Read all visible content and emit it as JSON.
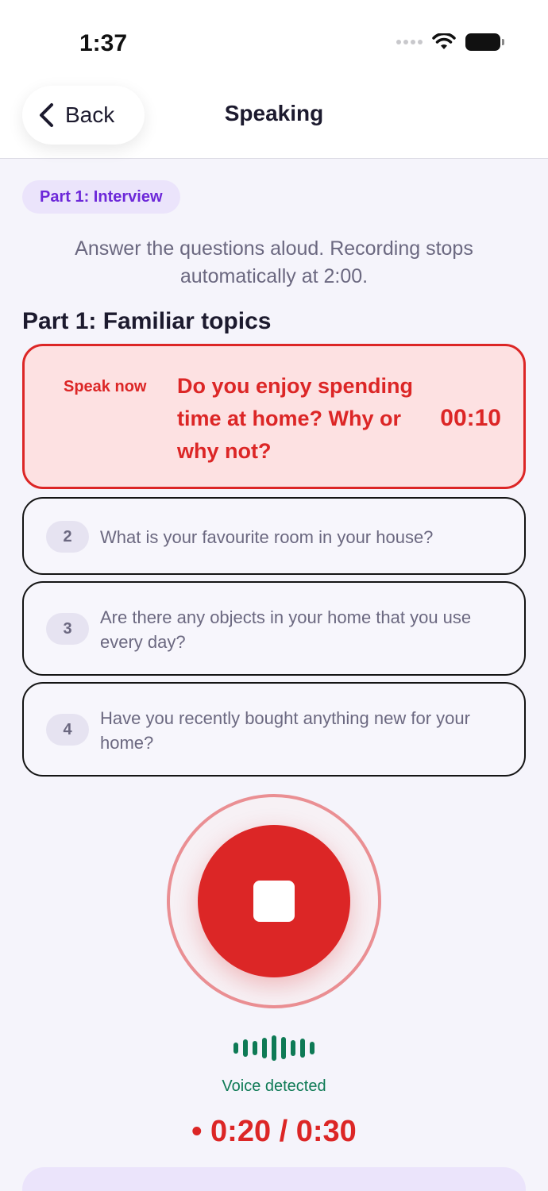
{
  "status_bar": {
    "time": "1:37"
  },
  "nav": {
    "back_label": "Back",
    "title": "Speaking"
  },
  "part_pill": "Part 1: Interview",
  "instructions": "Answer the questions aloud. Recording stops automatically at 2:00.",
  "section_title": "Part 1: Familiar topics",
  "active_question": {
    "status": "Speak now",
    "text": "Do you enjoy spending time at home? Why or why not?",
    "timer": "00:10"
  },
  "questions": [
    {
      "number": "2",
      "text": "What is your favourite room in your house?"
    },
    {
      "number": "3",
      "text": "Are there any objects in your home that you use every day?"
    },
    {
      "number": "4",
      "text": "Have you recently bought anything new for your home?"
    }
  ],
  "recorder": {
    "voice_status": "Voice detected",
    "elapsed": "• 0:20 / 0:30",
    "icon": "stop-icon"
  },
  "colors": {
    "accent_red": "#dc2626",
    "accent_purple": "#6d28d9",
    "voice_green": "#0e7a55",
    "background": "#f5f4fb"
  }
}
